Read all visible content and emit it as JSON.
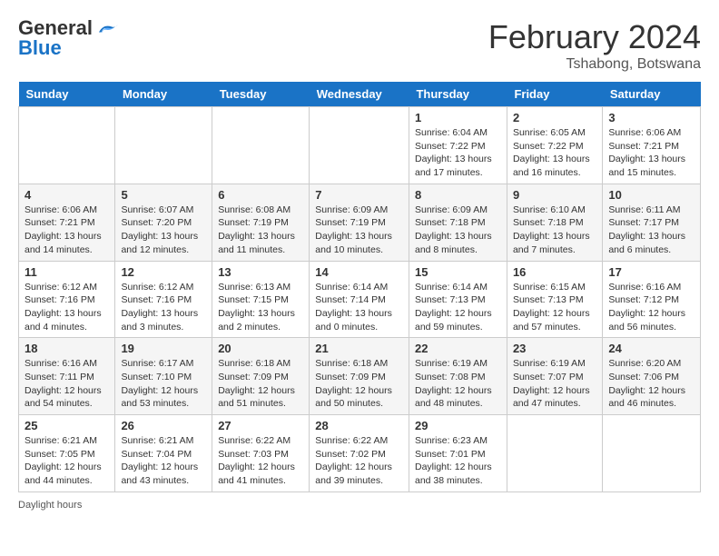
{
  "header": {
    "logo_general": "General",
    "logo_blue": "Blue",
    "month_title": "February 2024",
    "location": "Tshabong, Botswana"
  },
  "days_of_week": [
    "Sunday",
    "Monday",
    "Tuesday",
    "Wednesday",
    "Thursday",
    "Friday",
    "Saturday"
  ],
  "weeks": [
    [
      {
        "day": "",
        "info": ""
      },
      {
        "day": "",
        "info": ""
      },
      {
        "day": "",
        "info": ""
      },
      {
        "day": "",
        "info": ""
      },
      {
        "day": "1",
        "info": "Sunrise: 6:04 AM\nSunset: 7:22 PM\nDaylight: 13 hours and 17 minutes."
      },
      {
        "day": "2",
        "info": "Sunrise: 6:05 AM\nSunset: 7:22 PM\nDaylight: 13 hours and 16 minutes."
      },
      {
        "day": "3",
        "info": "Sunrise: 6:06 AM\nSunset: 7:21 PM\nDaylight: 13 hours and 15 minutes."
      }
    ],
    [
      {
        "day": "4",
        "info": "Sunrise: 6:06 AM\nSunset: 7:21 PM\nDaylight: 13 hours and 14 minutes."
      },
      {
        "day": "5",
        "info": "Sunrise: 6:07 AM\nSunset: 7:20 PM\nDaylight: 13 hours and 12 minutes."
      },
      {
        "day": "6",
        "info": "Sunrise: 6:08 AM\nSunset: 7:19 PM\nDaylight: 13 hours and 11 minutes."
      },
      {
        "day": "7",
        "info": "Sunrise: 6:09 AM\nSunset: 7:19 PM\nDaylight: 13 hours and 10 minutes."
      },
      {
        "day": "8",
        "info": "Sunrise: 6:09 AM\nSunset: 7:18 PM\nDaylight: 13 hours and 8 minutes."
      },
      {
        "day": "9",
        "info": "Sunrise: 6:10 AM\nSunset: 7:18 PM\nDaylight: 13 hours and 7 minutes."
      },
      {
        "day": "10",
        "info": "Sunrise: 6:11 AM\nSunset: 7:17 PM\nDaylight: 13 hours and 6 minutes."
      }
    ],
    [
      {
        "day": "11",
        "info": "Sunrise: 6:12 AM\nSunset: 7:16 PM\nDaylight: 13 hours and 4 minutes."
      },
      {
        "day": "12",
        "info": "Sunrise: 6:12 AM\nSunset: 7:16 PM\nDaylight: 13 hours and 3 minutes."
      },
      {
        "day": "13",
        "info": "Sunrise: 6:13 AM\nSunset: 7:15 PM\nDaylight: 13 hours and 2 minutes."
      },
      {
        "day": "14",
        "info": "Sunrise: 6:14 AM\nSunset: 7:14 PM\nDaylight: 13 hours and 0 minutes."
      },
      {
        "day": "15",
        "info": "Sunrise: 6:14 AM\nSunset: 7:13 PM\nDaylight: 12 hours and 59 minutes."
      },
      {
        "day": "16",
        "info": "Sunrise: 6:15 AM\nSunset: 7:13 PM\nDaylight: 12 hours and 57 minutes."
      },
      {
        "day": "17",
        "info": "Sunrise: 6:16 AM\nSunset: 7:12 PM\nDaylight: 12 hours and 56 minutes."
      }
    ],
    [
      {
        "day": "18",
        "info": "Sunrise: 6:16 AM\nSunset: 7:11 PM\nDaylight: 12 hours and 54 minutes."
      },
      {
        "day": "19",
        "info": "Sunrise: 6:17 AM\nSunset: 7:10 PM\nDaylight: 12 hours and 53 minutes."
      },
      {
        "day": "20",
        "info": "Sunrise: 6:18 AM\nSunset: 7:09 PM\nDaylight: 12 hours and 51 minutes."
      },
      {
        "day": "21",
        "info": "Sunrise: 6:18 AM\nSunset: 7:09 PM\nDaylight: 12 hours and 50 minutes."
      },
      {
        "day": "22",
        "info": "Sunrise: 6:19 AM\nSunset: 7:08 PM\nDaylight: 12 hours and 48 minutes."
      },
      {
        "day": "23",
        "info": "Sunrise: 6:19 AM\nSunset: 7:07 PM\nDaylight: 12 hours and 47 minutes."
      },
      {
        "day": "24",
        "info": "Sunrise: 6:20 AM\nSunset: 7:06 PM\nDaylight: 12 hours and 46 minutes."
      }
    ],
    [
      {
        "day": "25",
        "info": "Sunrise: 6:21 AM\nSunset: 7:05 PM\nDaylight: 12 hours and 44 minutes."
      },
      {
        "day": "26",
        "info": "Sunrise: 6:21 AM\nSunset: 7:04 PM\nDaylight: 12 hours and 43 minutes."
      },
      {
        "day": "27",
        "info": "Sunrise: 6:22 AM\nSunset: 7:03 PM\nDaylight: 12 hours and 41 minutes."
      },
      {
        "day": "28",
        "info": "Sunrise: 6:22 AM\nSunset: 7:02 PM\nDaylight: 12 hours and 39 minutes."
      },
      {
        "day": "29",
        "info": "Sunrise: 6:23 AM\nSunset: 7:01 PM\nDaylight: 12 hours and 38 minutes."
      },
      {
        "day": "",
        "info": ""
      },
      {
        "day": "",
        "info": ""
      }
    ]
  ],
  "footer": {
    "note": "Daylight hours"
  },
  "colors": {
    "header_bg": "#1a73c6",
    "header_text": "#ffffff",
    "border": "#cccccc",
    "row_even": "#f5f5f5",
    "row_odd": "#ffffff"
  }
}
